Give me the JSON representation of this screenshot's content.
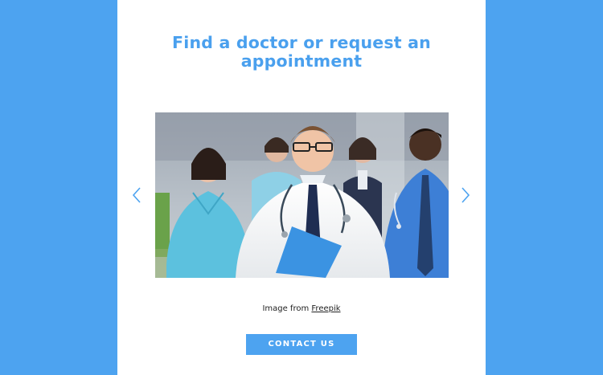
{
  "section": {
    "title": "Find a doctor or request an appointment"
  },
  "carousel": {
    "prev_icon": "chevron-left-icon",
    "next_icon": "chevron-right-icon",
    "slide_icon": "medical-team-photo"
  },
  "credit": {
    "prefix": "Image from",
    "link_text": "Freepik"
  },
  "cta": {
    "label": "CONTACT US"
  },
  "colors": {
    "accent": "#4da3f0",
    "heading": "#4aa0ee",
    "card": "#ffffff"
  }
}
